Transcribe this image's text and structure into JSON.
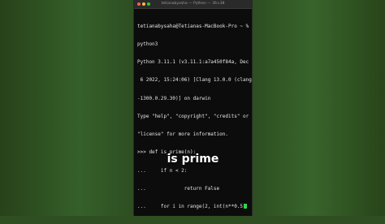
{
  "window": {
    "title": "tetianabysaha — Python — 36×38"
  },
  "terminal": {
    "lines": [
      "tetianabysaha@Tetianas-MacBook-Pro ~ %",
      "python3",
      "Python 3.11.1 (v3.11.1:a7a450f84a, Dec",
      " 6 2022, 15:24:06) [Clang 13.0.0 (clang",
      "-1300.0.29.30)] on darwin",
      "Type \"help\", \"copyright\", \"credits\" or",
      "\"license\" for more information.",
      ">>> def is_prime(n):",
      "...     if n < 2:",
      "...             return False",
      "...     for i in range(2, int(n**0.5"
    ]
  },
  "caption": "is prime"
}
